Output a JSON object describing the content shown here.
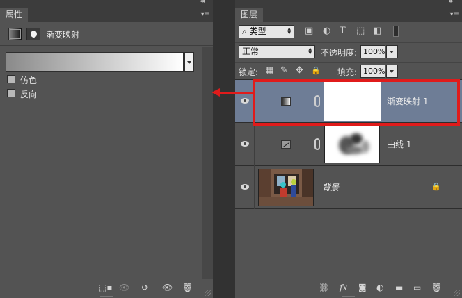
{
  "properties_panel": {
    "tab_label": "属性",
    "collapse_glyph": "◂◂",
    "menu_glyph": "▾≡",
    "title": "渐变映射",
    "options": [
      {
        "label": "仿色",
        "checked": false
      },
      {
        "label": "反向",
        "checked": false
      }
    ],
    "footer_icons": {
      "clip": "⬚▪",
      "view_previous": "👁",
      "reset": "↺",
      "visibility": "👁",
      "trash": "🗑"
    }
  },
  "layers_panel": {
    "tab_label": "图层",
    "collapse_glyph": "▸▸",
    "menu_glyph": "▾≡",
    "filter": {
      "value": "类型",
      "search_glyph": "⌕"
    },
    "filter_icons": {
      "image": "▣",
      "adjustment": "◐",
      "type": "T",
      "shape": "⬚",
      "smart": "◧"
    },
    "blend_mode": "正常",
    "opacity_label": "不透明度:",
    "opacity_value": "100%",
    "lock_label": "锁定:",
    "lock_icons": {
      "transparent": "▦",
      "pixels": "✎",
      "position": "✥",
      "all": "🔒"
    },
    "fill_label": "填充:",
    "fill_value": "100%",
    "layers": [
      {
        "name": "渐变映射",
        "number": "1",
        "selected": true,
        "kind": "gradient-map"
      },
      {
        "name": "曲线",
        "number": "1",
        "selected": false,
        "kind": "curves"
      },
      {
        "name": "背景",
        "number": "",
        "selected": false,
        "kind": "background",
        "locked": true
      }
    ],
    "footer_icons": {
      "link": "⛓",
      "fx": "fx",
      "mask": "◙",
      "adjustment": "◐",
      "group": "▬",
      "new": "▭",
      "trash": "🗑"
    }
  },
  "colors": {
    "panel_bg": "#535353",
    "selected_row": "#6e7d96",
    "annotation_red": "#e01b1b"
  }
}
